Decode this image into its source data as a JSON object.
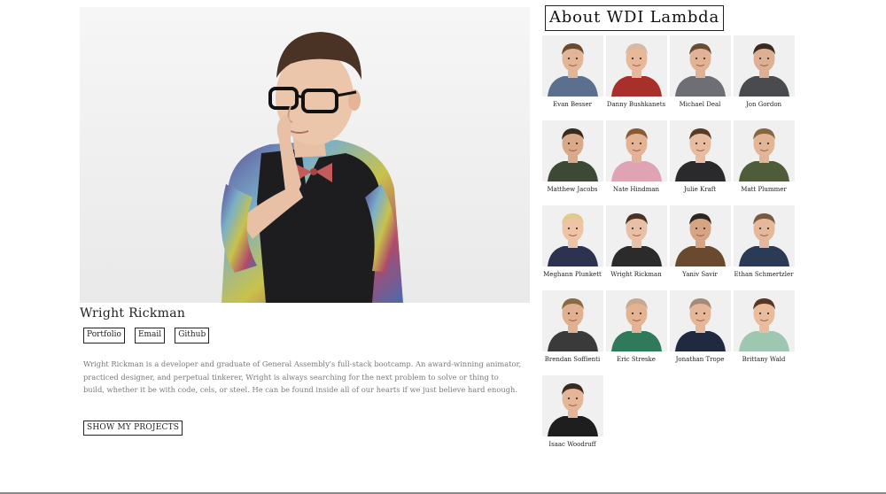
{
  "profile": {
    "name": "Wright Rickman",
    "links": [
      "Portfolio",
      "Email",
      "Github"
    ],
    "bio": "Wright Rickman is a developer and graduate of General Assembly's full-stack bootcamp. An award-winning animator, practiced designer, and perpetual tinkerer, Wright is always searching for the next problem to solve or thing to build, whether it be with code, cels, or steel. He can be found inside all of our hearts if we just believe hard enough.",
    "projects_button": "SHOW MY PROJECTS"
  },
  "class_section": {
    "title": "About WDI Lambda",
    "people": [
      {
        "name": "Evan Besser",
        "shirt": "#5b6f8e",
        "hair": "#6b4a2e",
        "skin": "#e2b596"
      },
      {
        "name": "Danny Bushkanets",
        "shirt": "#a9302a",
        "hair": "#d9b9a0",
        "skin": "#e7b89a"
      },
      {
        "name": "Michael Deal",
        "shirt": "#6d6f74",
        "hair": "#6a4b33",
        "skin": "#e1b394"
      },
      {
        "name": "Jon Gordon",
        "shirt": "#4a4b4f",
        "hair": "#3a2b20",
        "skin": "#ddb094"
      },
      {
        "name": "Matthew Jacobs",
        "shirt": "#3c4a35",
        "hair": "#3a2a1f",
        "skin": "#d9a989"
      },
      {
        "name": "Nate Hindman",
        "shirt": "#e0a3b4",
        "hair": "#8a5a35",
        "skin": "#e4b294"
      },
      {
        "name": "Julie Kraft",
        "shirt": "#2a2a2d",
        "hair": "#5a3a24",
        "skin": "#e7bca0"
      },
      {
        "name": "Matt Plummer",
        "shirt": "#4e5c3a",
        "hair": "#8a6640",
        "skin": "#e2b596"
      },
      {
        "name": "Meghann Plunkett",
        "shirt": "#2c3350",
        "hair": "#e2c98c",
        "skin": "#eec3a6"
      },
      {
        "name": "Wright Rickman",
        "shirt": "#2b2b2b",
        "hair": "#4a3324",
        "skin": "#e8c0a5"
      },
      {
        "name": "Yaniv Savir",
        "shirt": "#6a4a2e",
        "hair": "#2e2520",
        "skin": "#d6a483"
      },
      {
        "name": "Ethan Schmertzler",
        "shirt": "#2b3a55",
        "hair": "#7a5a3a",
        "skin": "#e4b89a"
      },
      {
        "name": "Brendan Soffienti",
        "shirt": "#3a3a3a",
        "hair": "#8a6a45",
        "skin": "#e0b090"
      },
      {
        "name": "Eric Streske",
        "shirt": "#2e7a5a",
        "hair": "#c9a88c",
        "skin": "#e4b394"
      },
      {
        "name": "Jonathan Trope",
        "shirt": "#1f2a40",
        "hair": "#a48a78",
        "skin": "#e6b699"
      },
      {
        "name": "Brittany Wald",
        "shirt": "#9ec7b1",
        "hair": "#5a3520",
        "skin": "#e8bc9d"
      },
      {
        "name": "Isaac Woodruff",
        "shirt": "#1e1e1e",
        "hair": "#3a2b22",
        "skin": "#e4b596"
      }
    ]
  }
}
